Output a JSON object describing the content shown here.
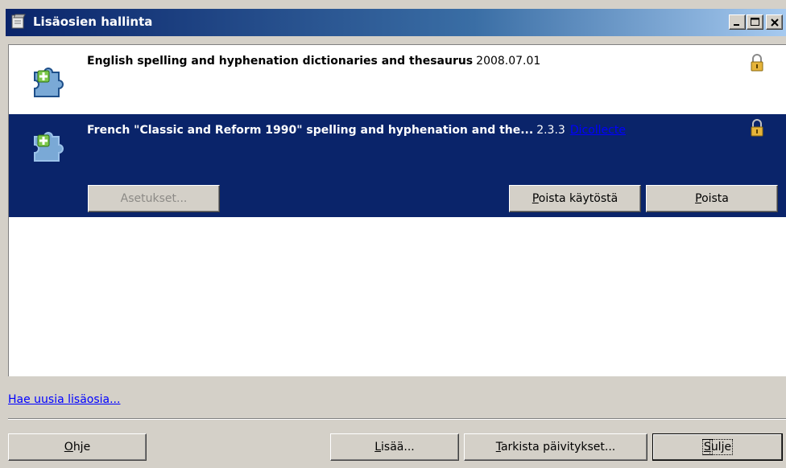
{
  "window": {
    "title": "Lisäosien hallinta",
    "controls": [
      "minimize",
      "maximize",
      "close"
    ]
  },
  "extensions": [
    {
      "name": "English spelling and hyphenation dictionaries and thesaurus",
      "version": "2008.07.01",
      "icon": "puzzle-icon",
      "locked": true
    },
    {
      "name": "French \"Classic and Reform 1990\" spelling and hyphenation and the...",
      "version": "2.3.3",
      "link": "Dicollecte",
      "icon": "puzzle-icon",
      "locked": true,
      "selected": true,
      "buttons": {
        "settings": "Asetukset...",
        "disable_u": "P",
        "disable_rest": "oista käytöstä",
        "remove_u": "P",
        "remove_rest": "oista"
      }
    }
  ],
  "get_more_link": "Hae uusia lisäosia...",
  "footer": {
    "help_u": "O",
    "help_rest": "hje",
    "add_u": "L",
    "add_rest": "isää...",
    "check_u": "T",
    "check_rest": "arkista päivitykset...",
    "close_u": "S",
    "close_rest": "ulje"
  },
  "colors": {
    "selection": "#0a246a",
    "face": "#d4d0c8",
    "link": "#0000ff"
  }
}
